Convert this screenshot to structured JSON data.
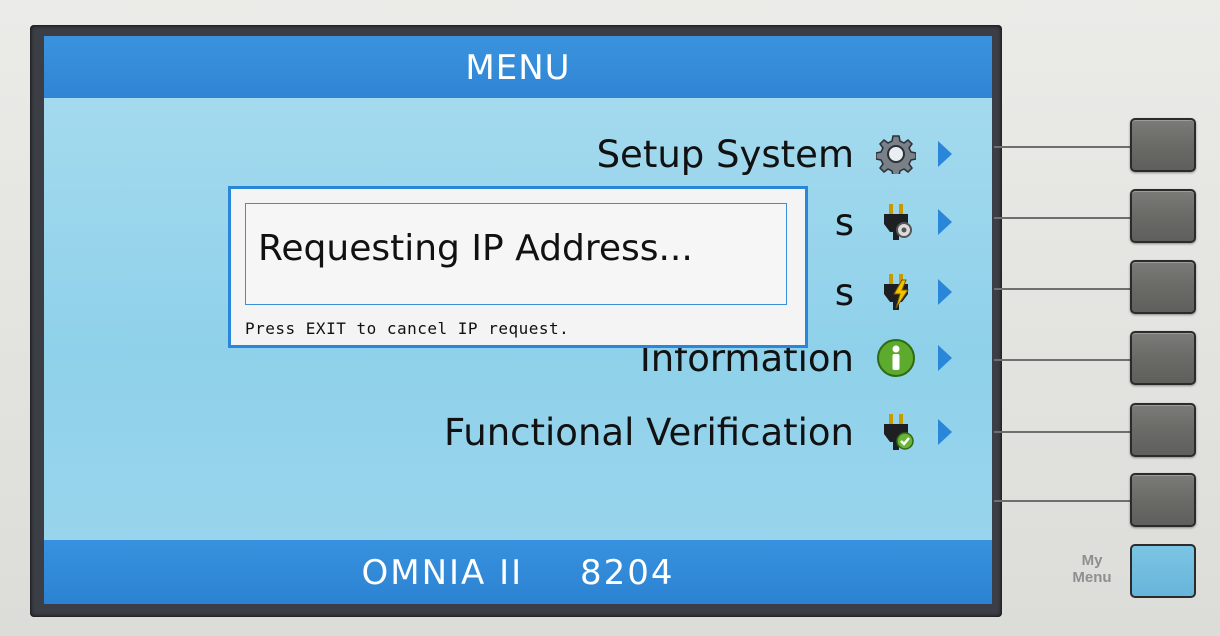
{
  "screen": {
    "title": "MENU",
    "footer_model": "OMNIA II",
    "footer_number": "8204"
  },
  "menu": {
    "items": [
      {
        "label": "Setup System",
        "icon": "gear-icon"
      },
      {
        "label": "s",
        "icon": "plug-gear-icon"
      },
      {
        "label": "s",
        "icon": "plug-lightning-icon"
      },
      {
        "label": "Information",
        "icon": "info-icon"
      },
      {
        "label": "Functional Verification",
        "icon": "plug-check-icon"
      }
    ]
  },
  "dialog": {
    "message": "Requesting IP Address...",
    "hint": "Press EXIT to cancel IP request."
  },
  "hardware": {
    "my_menu_label": "My Menu"
  },
  "colors": {
    "title_bar": "#2f85d4",
    "screen_bg": "#a9dcef",
    "arrow": "#2a86d8",
    "my_menu_button": "#6fbbe0"
  }
}
